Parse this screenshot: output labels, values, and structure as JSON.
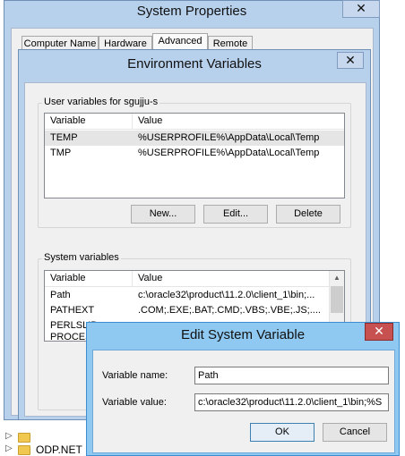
{
  "system_properties": {
    "title": "System Properties",
    "close_glyph": "✕",
    "tabs": [
      {
        "label": "Computer Name"
      },
      {
        "label": "Hardware"
      },
      {
        "label": "Advanced"
      },
      {
        "label": "Remote"
      }
    ]
  },
  "environment_variables": {
    "title": "Environment Variables",
    "close_glyph": "✕",
    "user_group_label": "User variables for sgujju-s",
    "user_columns": [
      "Variable",
      "Value"
    ],
    "user_rows": [
      {
        "variable": "TEMP",
        "value": "%USERPROFILE%\\AppData\\Local\\Temp"
      },
      {
        "variable": "TMP",
        "value": "%USERPROFILE%\\AppData\\Local\\Temp"
      }
    ],
    "user_buttons": {
      "new": "New...",
      "edit": "Edit...",
      "delete": "Delete"
    },
    "system_group_label": "System variables",
    "system_columns": [
      "Variable",
      "Value"
    ],
    "system_rows": [
      {
        "variable": "Path",
        "value": "c:\\oracle32\\product\\11.2.0\\client_1\\bin;..."
      },
      {
        "variable": "PATHEXT",
        "value": ".COM;.EXE;.BAT;.CMD;.VBS;.VBE;.JS;...."
      },
      {
        "variable": "PERLSLIB",
        "value": ""
      },
      {
        "variable": "PROCES",
        "value": ""
      }
    ],
    "scroll_up": "▲"
  },
  "edit_system_variable": {
    "title": "Edit System Variable",
    "close_glyph": "✕",
    "name_label": "Variable name:",
    "name_value": "Path",
    "value_label": "Variable value:",
    "value_value": "c:\\oracle32\\product\\11.2.0\\client_1\\bin;%S",
    "ok_label": "OK",
    "cancel_label": "Cancel"
  },
  "explorer": {
    "odp_label": "ODP.NET",
    "arrow": "▷"
  },
  "colors": {
    "window_frame": "#b7d0ec",
    "active_frame": "#8fc8f0",
    "close_red": "#c75050"
  }
}
